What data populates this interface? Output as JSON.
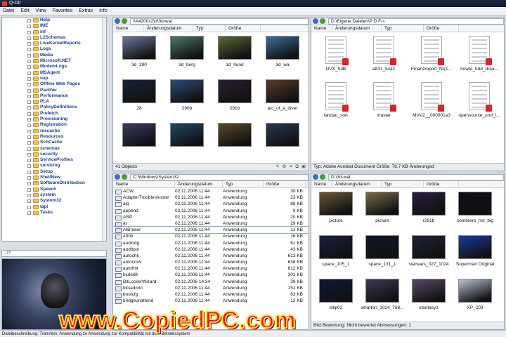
{
  "app": {
    "title": "Q-Dir"
  },
  "menu": [
    "Datei",
    "Edit",
    "View",
    "Favorites",
    "Extras",
    "Info"
  ],
  "tree": {
    "items": [
      "Help",
      "IME",
      "inf",
      "L2Schemas",
      "LiveKernelReports",
      "Logs",
      "Media",
      "Microsoft.NET",
      "ModemLogs",
      "MSAgent",
      "nap",
      "Offline Web Pages",
      "Panther",
      "Performance",
      "PLA",
      "PolicyDefinitions",
      "Prefetch",
      "Provisioning",
      "Registration",
      "rescache",
      "Resources",
      "SchCache",
      "schemas",
      "security",
      "ServiceProfiles",
      "servicing",
      "Setup",
      "ShellNew",
      "SoftwareDistribution",
      "Speech",
      "system",
      "System32",
      "tapi",
      "Tasks"
    ],
    "path": "...!?"
  },
  "pane_tl": {
    "path": "\\\\A4200x2\\d\\3d-wal",
    "columns": [
      "Name",
      "Änderungsdatum",
      "Typ",
      "Größe"
    ],
    "items": [
      {
        "name": "3d_280",
        "color": "#6b7aa0"
      },
      {
        "name": "3d_berg",
        "color": "#4a7a6a"
      },
      {
        "name": "3d_hund",
        "color": "#5b6a3a"
      },
      {
        "name": "3d_wa",
        "color": "#3d6d9c"
      },
      {
        "name": "28",
        "color": "#1a2438"
      },
      {
        "name": "290b",
        "color": "#2d4c7a"
      },
      {
        "name": "291b",
        "color": "#2a1e34"
      },
      {
        "name": "arc_of_a_diver",
        "color": "#5a3a2a"
      },
      {
        "name": "",
        "color": "#3a3a6a"
      },
      {
        "name": "",
        "color": "#1e4a6a"
      },
      {
        "name": "",
        "color": "#5a4a2a"
      },
      {
        "name": "",
        "color": "#263a56"
      }
    ],
    "status": "41 Objects"
  },
  "pane_tr": {
    "path": "D:\\Eigene Dateien\\P D F-s",
    "columns": [
      "Name",
      "Änderungsdatum",
      "Typ",
      "Größe"
    ],
    "items": [
      "DVX_53B",
      "e831_tusl2",
      "Finanzreport_Nr(1...",
      "howto_hdd_drea...",
      "landau_sort",
      "master",
      "MVV2__000001a3",
      "opensource_und_l..."
    ],
    "status": "Typ: Adobe Acrobat Document Größe: 78,7 KB Änderungsd"
  },
  "pane_bl": {
    "path": "C:\\Windows\\System32",
    "columns": [
      "Name",
      "Änderungsdatum",
      "Typ",
      "Größe"
    ],
    "rows": [
      [
        "ACW",
        "02.11.2006 11:44",
        "Anwendung",
        "30 KB"
      ],
      [
        "AdapterTroubleshooter",
        "02.11.2006 11:44",
        "Anwendung",
        "23 KB"
      ],
      [
        "alg",
        "02.11.2006 11:44",
        "Anwendung",
        "88 KB"
      ],
      [
        "append",
        "02.11.2006 11:44",
        "Anwendung",
        "9 KB"
      ],
      [
        "ARP",
        "02.11.2006 11:44",
        "Anwendung",
        "20 KB"
      ],
      [
        "at",
        "02.11.2006 11:44",
        "Anwendung",
        "29 KB"
      ],
      [
        "AtBroker",
        "02.11.2006 11:44",
        "Anwendung",
        "11 KB"
      ],
      [
        "attrib",
        "02.11.2006 11:44",
        "Anwendung",
        "16 KB"
      ],
      [
        "audiodg",
        "02.11.2006 11:44",
        "Anwendung",
        "61 KB"
      ],
      [
        "auditpol",
        "02.11.2006 11:44",
        "Anwendung",
        "43 KB"
      ],
      [
        "autochk",
        "02.11.2006 11:44",
        "Anwendung",
        "613 KB"
      ],
      [
        "autoconv",
        "02.11.2006 11:44",
        "Anwendung",
        "638 KB"
      ],
      [
        "autofmt",
        "02.11.2006 11:44",
        "Anwendung",
        "612 KB"
      ],
      [
        "bcdedit",
        "02.11.2006 11:44",
        "Anwendung",
        "301 KB"
      ],
      [
        "BitLockerWizard",
        "02.11.2006 14:34",
        "Anwendung",
        "39 KB"
      ],
      [
        "bitsadmin",
        "02.11.2006 11:44",
        "Anwendung",
        "151 KB"
      ],
      [
        "bootcfg",
        "02.11.2006 11:44",
        "Anwendung",
        "83 KB"
      ],
      [
        "bridgeunattend",
        "02.11.2006 11:44",
        "Anwendung",
        "12 KB"
      ]
    ],
    "status": "System32"
  },
  "pane_br": {
    "path": "D:\\3d-wal",
    "columns": [
      "Name",
      "Änderungsdatum",
      "Typ",
      "Größe"
    ],
    "items": [
      {
        "name": "picture",
        "color": "#6a5838"
      },
      {
        "name": "picture",
        "color": "#7a6a4a"
      },
      {
        "name": "r291b",
        "color": "#2a2040"
      },
      {
        "name": "sombrero_hst_big",
        "color": "#0e0e18"
      },
      {
        "name": "space_105_1",
        "color": "#1a2040"
      },
      {
        "name": "space_131_1",
        "color": "#101828"
      },
      {
        "name": "starwars_027_1024",
        "color": "#1c2436"
      },
      {
        "name": "Superman Original",
        "color": "#1a3aa0"
      },
      {
        "name": "ellip02",
        "color": "#0e1a3a"
      },
      {
        "name": "wharton_1024_768...",
        "color": "#3a3a5a"
      },
      {
        "name": "xfantasy1",
        "color": "#5a4a6a"
      },
      {
        "name": "XP_203",
        "color": "#b8c0d4"
      }
    ],
    "status": "Bild Bewertung: Nicht bewertet Abmessungen: 1"
  },
  "bottom_status": "Dateibeschreibung: Transfers: Anwendung zu Anwendung zur Kompatibilität mit dem Betriebssystem",
  "watermark": "www.CopiedPC.com"
}
